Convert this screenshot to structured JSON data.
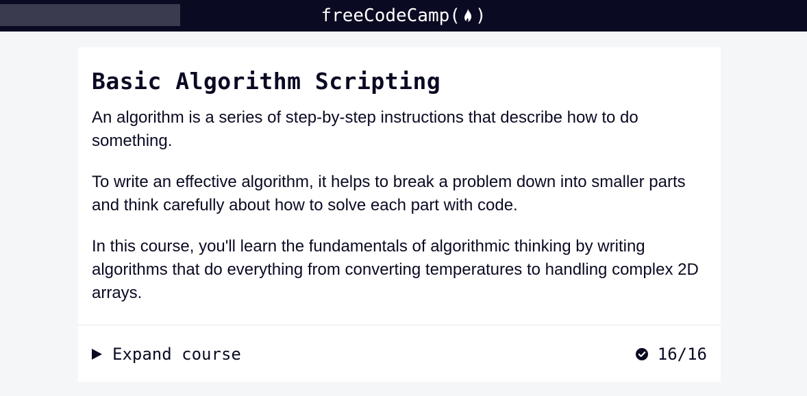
{
  "navbar": {
    "search_placeholder": "",
    "logo_prefix": "freeCodeCamp(",
    "logo_suffix": ")",
    "logo_icon": "flame-icon"
  },
  "course": {
    "title": "Basic Algorithm Scripting",
    "paragraphs": [
      "An algorithm is a series of step-by-step instructions that describe how to do something.",
      "To write an effective algorithm, it helps to break a problem down into smaller parts and think carefully about how to solve each part with code.",
      "In this course, you'll learn the fundamentals of algorithmic thinking by writing algorithms that do everything from converting temperatures to handling complex 2D arrays."
    ],
    "expand_label": "Expand course",
    "expand_icon": "caret-right-icon",
    "progress_icon": "check-circle-icon",
    "progress_text": "16/16"
  },
  "colors": {
    "navbar_bg": "#0a0a23",
    "search_bg": "#3b3b4f",
    "page_bg": "#f5f6f7",
    "text": "#0a0a23"
  }
}
